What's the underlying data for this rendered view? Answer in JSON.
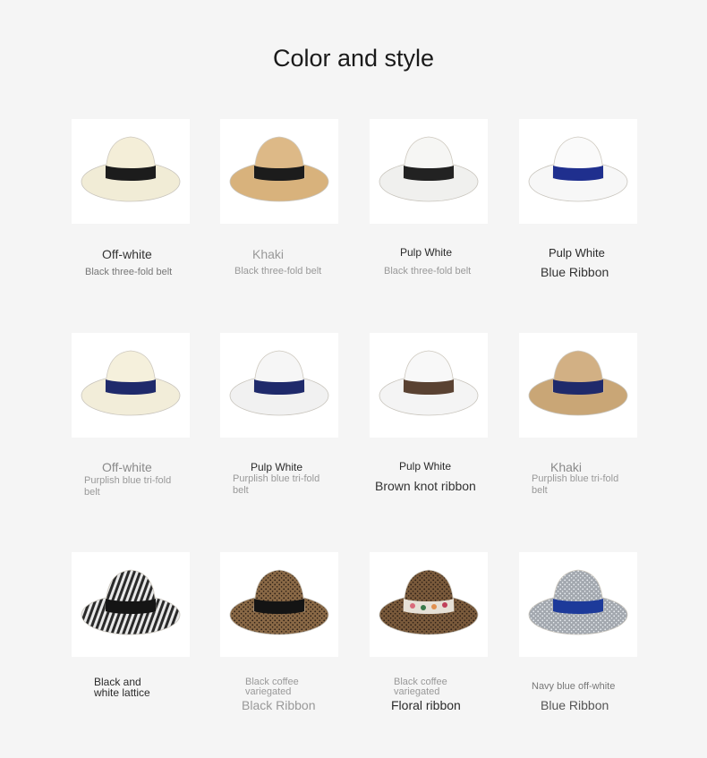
{
  "title": "Color and style",
  "products": [
    {
      "name": "Off-white",
      "desc": "Black three-fold belt",
      "brim": "#f1ecd6",
      "crown": "#f4eed8",
      "band": "#1c1c1c",
      "texture": "solid"
    },
    {
      "name": "Khaki",
      "desc": "Black three-fold belt",
      "brim": "#d8b27c",
      "crown": "#ddb987",
      "band": "#1c1c1c",
      "texture": "solid"
    },
    {
      "name": "Pulp White",
      "desc": "Black three-fold belt",
      "brim": "#f0f0ee",
      "crown": "#f6f6f4",
      "band": "#222222",
      "texture": "solid"
    },
    {
      "name": "Pulp White",
      "desc": "Blue Ribbon",
      "brim": "#f7f7f7",
      "crown": "#fafafa",
      "band": "#1f2f8e",
      "texture": "solid"
    },
    {
      "name": "Off-white",
      "desc": "Purplish blue tri-fold belt",
      "brim": "#f2edd9",
      "crown": "#f5f0dc",
      "band": "#1f2a6b",
      "texture": "solid"
    },
    {
      "name": "Pulp White",
      "desc": "Purplish blue tri-fold belt",
      "brim": "#f1f1f1",
      "crown": "#f6f6f6",
      "band": "#1f2a6b",
      "texture": "solid"
    },
    {
      "name": "Pulp White",
      "desc": "Brown knot ribbon",
      "brim": "#f4f4f4",
      "crown": "#f8f8f8",
      "band": "#5a4232",
      "texture": "solid"
    },
    {
      "name": "Khaki",
      "desc": "Purplish blue tri-fold belt",
      "brim": "#c9a676",
      "crown": "#d2b084",
      "band": "#1f2a6b",
      "texture": "solid"
    },
    {
      "name": "Black and white lattice",
      "desc": "",
      "brim": "#9a9a9a",
      "crown": "#8e8e8e",
      "band": "#151515",
      "texture": "stripes"
    },
    {
      "name": "Black coffee variegated",
      "desc": "Black Ribbon",
      "brim": "#8b6a45",
      "crown": "#8a6946",
      "band": "#141414",
      "texture": "speckle"
    },
    {
      "name": "Black coffee variegated",
      "desc": "Floral ribbon",
      "brim": "#7d5c3c",
      "crown": "#7a5a3b",
      "band": "#e6e0d6",
      "texture": "speckle"
    },
    {
      "name": "Navy blue off-white",
      "desc": "Blue Ribbon",
      "brim": "#a8adb3",
      "crown": "#a2a7ae",
      "band": "#1d3a9a",
      "texture": "speckle-light"
    }
  ]
}
